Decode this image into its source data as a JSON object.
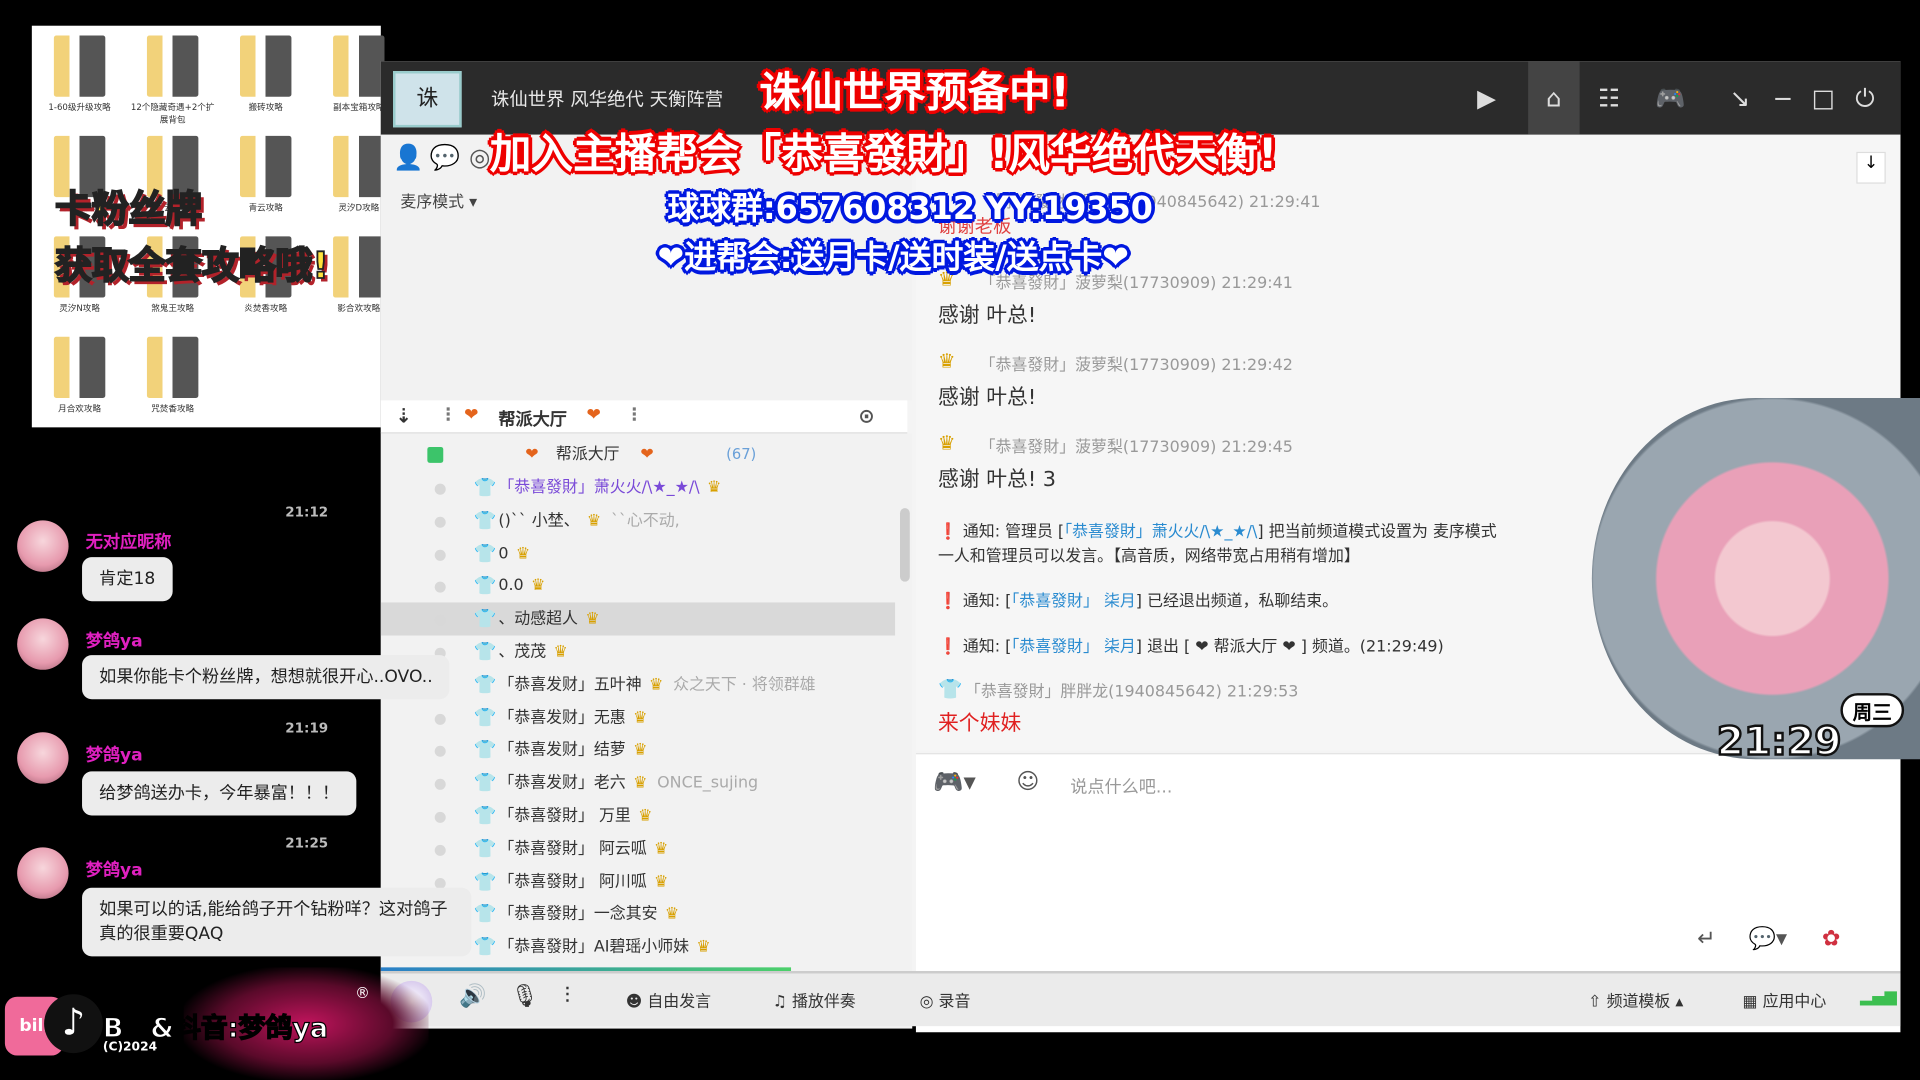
{
  "thumbnails": {
    "folders": [
      "1-60级升级攻略",
      "12个隐藏奇遇+2个扩展背包",
      "搬砖攻略",
      "副本宝箱攻略",
      "鬼王TJ攻略",
      "青云攻略",
      "青云攻略",
      "灵汐D攻略",
      "灵汐N攻略",
      "煞鬼王攻略",
      "炎焚香攻略",
      "影合欢攻略",
      "月合欢攻略",
      "咒焚香攻略"
    ],
    "promo_line1": "卡粉丝牌",
    "promo_line2": "获取全套攻略哦!"
  },
  "overlay": {
    "line1": "诛仙世界预备中!",
    "line2": "加入主播帮会「恭喜發財」!风华绝代天衡!",
    "line3": "球球群:657608312   YY:19350",
    "line4": "❤进帮会:送月卡/送时装/送点卡❤"
  },
  "window": {
    "channel_title": "诛仙世界 风华绝代 天衡阵营",
    "logo_text": "诛",
    "mode_label": "麦序模式",
    "channel_bar": {
      "name": "帮派大厅"
    },
    "tree": {
      "root": {
        "name": "帮派大厅",
        "count": "(67)"
      },
      "members": [
        {
          "name": "「恭喜發財」萧火火/\\★_★/\\",
          "color": "#7a4ad8",
          "shirt": "#f0b400",
          "extra": ""
        },
        {
          "name": "()`` 小埜、",
          "shirt": "#3aa0d8",
          "extra": "``心不动,"
        },
        {
          "name": "0",
          "shirt": "#3aa0d8",
          "extra": ""
        },
        {
          "name": "0.0",
          "shirt": "#3aa0d8",
          "extra": ""
        },
        {
          "name": "、动感超人",
          "shirt": "#3aa0d8",
          "extra": ""
        },
        {
          "name": "、茂茂",
          "shirt": "#3aa0d8",
          "extra": ""
        },
        {
          "name": "「恭喜发财」五叶神",
          "shirt": "#f0b400",
          "extra": "众之天下 · 将领群雄"
        },
        {
          "name": "「恭喜发财」无惠",
          "shirt": "#f0b400",
          "extra": ""
        },
        {
          "name": "「恭喜发财」结萝",
          "shirt": "#3aa0d8",
          "extra": ""
        },
        {
          "name": "「恭喜发财」老六",
          "shirt": "#e83a9a",
          "extra": "ONCE_sujing"
        },
        {
          "name": "「恭喜發財」 万里",
          "shirt": "#3aa0d8",
          "extra": ""
        },
        {
          "name": "「恭喜發財」 阿云呱",
          "shirt": "#f0b400",
          "extra": ""
        },
        {
          "name": "「恭喜發財」 阿川呱",
          "shirt": "#f0b400",
          "extra": ""
        },
        {
          "name": "「恭喜發財」一念其安",
          "shirt": "#f0b400",
          "extra": ""
        },
        {
          "name": "「恭喜發財」AI碧瑶小师妹",
          "shirt": "#f0b400",
          "extra": ""
        }
      ]
    },
    "chat": {
      "messages": [
        {
          "header": "「恭喜發財」胖胖龙(1940845642) 21:29:41",
          "body": "谢谢老板"
        },
        {
          "header": "「恭喜發財」菠萝梨(17730909)  21:29:41",
          "body": "感谢 叶总!"
        },
        {
          "header": "「恭喜發財」菠萝梨(17730909)  21:29:42",
          "body": "感谢 叶总!"
        },
        {
          "header": "「恭喜發財」菠萝梨(17730909)  21:29:45",
          "body": "感谢 叶总! 3"
        }
      ],
      "notices": [
        {
          "prefix": "通知: 管理员 [",
          "link": "「恭喜發財」萧火火/\\★_★/\\",
          "suffix": "] 把当前频道模式设置为 麦序模式",
          "line2": "一人和管理员可以发言。【高音质，网络带宽占用稍有增加】"
        },
        {
          "prefix": "通知: [",
          "link": "「恭喜發財」 柒月",
          "suffix": "] 已经退出频道，私聊结束。"
        },
        {
          "prefix": "通知: [",
          "link": "「恭喜發財」 柒月",
          "suffix": "] 退出 [ ❤ 帮派大厅 ❤ ] 频道。(21:29:49)"
        }
      ],
      "last": {
        "header": "「恭喜發財」胖胖龙(1940845642)  21:29:53",
        "body": "来个妹妹"
      }
    },
    "input": {
      "placeholder": "说点什么吧..."
    },
    "bottombar": {
      "free_speak": "自由发言",
      "play_music": "播放伴奏",
      "record": "录音",
      "channel_template": "频道模板",
      "app_center": "应用中心"
    },
    "progress": 0.27
  },
  "left_chat": [
    {
      "time": "21:12",
      "name": "无对应昵称",
      "text": "肯定18"
    },
    {
      "time": "",
      "name": "梦鸽ya",
      "text": "如果你能卡个粉丝牌，想想就很开心..OVO.."
    },
    {
      "time": "21:19",
      "name": "梦鸽ya",
      "text": "给梦鸽送办卡，今年暴富！！！"
    },
    {
      "time": "21:25",
      "name": "梦鸽ya",
      "text": "如果可以的话,能给鸽子开个钻粉咩？这对鸽子真的很重要QAQ"
    }
  ],
  "stream": {
    "clock": "21:29",
    "weekday": "周三",
    "brand": "B站&抖音:梦鸽ya",
    "copyright": "(C)2024",
    "registered": "®"
  },
  "colors": {
    "accent_red": "#e00000",
    "accent_blue": "#0018e0",
    "name_pink": "#e020c0",
    "link_blue": "#2a8bd0"
  }
}
